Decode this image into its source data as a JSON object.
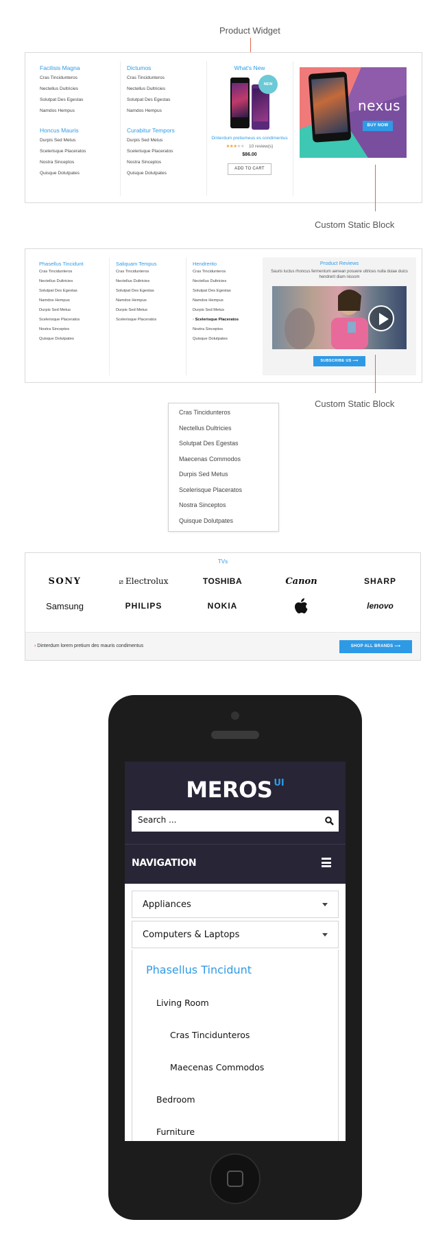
{
  "callouts": {
    "product_widget": "Product Widget",
    "custom_static_block_1": "Custom Static Block",
    "custom_static_block_2": "Custom Static Block"
  },
  "menu1": {
    "col1": {
      "title_a": "Facilisis Magna",
      "items_a": [
        "Cras Tincidunteros",
        "Nectellus Dultricies",
        "Solutpat Des Egestas",
        "Namdos Hempus"
      ],
      "title_b": "Honcus Mauris",
      "items_b": [
        "Durpis Sed Metus",
        "Scelerisque Placeratos",
        "Nostra Sinceptos",
        "Quisque Dolutpates"
      ]
    },
    "col2": {
      "title_a": "Dictumos",
      "items_a": [
        "Cras Tincidunteros",
        "Nectellus Dultricies",
        "Solutpat Des Egestas",
        "Namdos Hempus"
      ],
      "title_b": "Curabitur Tempors",
      "items_b": [
        "Durpis Sed Metus",
        "Scelerisque Placeratos",
        "Nostra Sinceptos",
        "Quisque Dolutpates"
      ]
    },
    "product": {
      "heading": "What's New",
      "badge": "NEW",
      "name": "Dinterdum pretiumeus es condimentus",
      "rating": 3.5,
      "reviews": "10 review(s)",
      "price": "$86.00",
      "cart_button": "ADD TO CART"
    },
    "banner": {
      "brand": "nexus",
      "button": "BUY NOW"
    }
  },
  "menu2": {
    "col1": {
      "title": "Phasellus Tincidunt",
      "items": [
        "Cras Tincidunteros",
        "Nectellus Dultricies",
        "Solutpat Des Egestas",
        "Namdos Hempus",
        "Durpis Sed Metus",
        "Scelerisque Placeratos",
        "Nostra Sinceptos",
        "Quisque Dolutpates"
      ]
    },
    "col2": {
      "title": "Saliquam Tempus",
      "items": [
        "Cras Tincidunteros",
        "Nectellus Dultricies",
        "Solutpat Des Egestas",
        "Namdos Hempus",
        "Durpis Sed Metus",
        "Scelerisque Placeratos"
      ]
    },
    "col3": {
      "title": "Hendrerito",
      "items": [
        "Cras Tincidunteros",
        "Nectellus Dultricies",
        "Solutpat Des Egestas",
        "Namdos Hempus",
        "Durpis Sed Metus",
        "Scelerisque Placeratos",
        "Nostra Sinceptos",
        "Quisque Dolutpates"
      ],
      "active_index": 5
    },
    "reviews": {
      "title": "Product Reviews",
      "text": "Sauris luctus rhoncus fermentum aenean posuere ultrices nulla duiae duics hendrerit diam nissom",
      "button": "SUBSCRIBE US"
    }
  },
  "dropdown": {
    "items": [
      "Cras Tincidunteros",
      "Nectellus Dultricies",
      "Solutpat Des Egestas",
      "Maecenas Commodos",
      "Durpis Sed Metus",
      "Scelerisque Placeratos",
      "Nostra Sinceptos",
      "Quisque Dolutpates"
    ]
  },
  "brands": {
    "title": "TVs",
    "row1": [
      "SONY",
      "Electrolux",
      "TOSHIBA",
      "Canon",
      "SHARP"
    ],
    "row2": [
      "Samsung",
      "PHILIPS",
      "NOKIA",
      "",
      "lenovo"
    ],
    "footer_text": "Dinterdum lorem pretium des mauris condimentus",
    "button": "SHOP ALL BRANDS"
  },
  "mobile": {
    "logo": "MEROS",
    "logo_sup": "UI",
    "search_placeholder": "Search ...",
    "nav_label": "NAVIGATION",
    "accordion": [
      "Appliances",
      "Computers & Laptops"
    ],
    "submenu_title": "Phasellus Tincidunt",
    "submenu": [
      "Living Room",
      "Cras Tincidunteros",
      "Maecenas Commodos",
      "Bedroom",
      "Furniture"
    ]
  },
  "colors": {
    "accent": "#2e9ae6",
    "callout": "#e0664a",
    "phone": "#1c1c1c",
    "mobile_header": "#272536"
  }
}
